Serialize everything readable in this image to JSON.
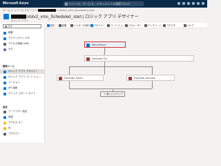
{
  "topbar": {
    "brand": "Microsoft Azure",
    "search_placeholder": "リソース、サービス、ドキュメントの検索 (G+/)"
  },
  "breadcrumb": {
    "prefix": "ホーム > リソース グループ >",
    "suffix": "> ststv2_vms_Scheduled_start"
  },
  "header": {
    "title_resource": "ststv2_vms_Scheduled_start",
    "title_sep": "|",
    "title_page": "ロジック アプリ デザイナー",
    "subtitle": "ロジック アプリ"
  },
  "sidebar": {
    "search_placeholder": "検索",
    "items_top": [
      "概要",
      "アクティビティ ログ",
      "アクセス制御 (IAM)",
      "タグ"
    ],
    "section_dev": "開発ツール",
    "items_dev": [
      "ロジック アプリ デザイナー",
      "ロジック アプリ コード ビュー",
      "バージョン",
      "API 接続",
      "クイック スタート ガイド"
    ],
    "section_settings": "設定",
    "items_settings": [
      "ワークフロー設定",
      "承認",
      "アクセス キー",
      "ID",
      "プロパティ"
    ]
  },
  "toolbar": [
    "保存",
    "破棄",
    "トリガーの実行",
    "デザイナー",
    "コード ビュー",
    "パラメーター",
    "テンプレート",
    "コネクタ",
    "ヘルプ"
  ],
  "canvas": {
    "recurrence": "Recurrence",
    "function_fly": "Function-Fly",
    "function_catch": "Function-Catch",
    "function_success": "Function-Success",
    "new_step": "+ 新しいステップ"
  }
}
